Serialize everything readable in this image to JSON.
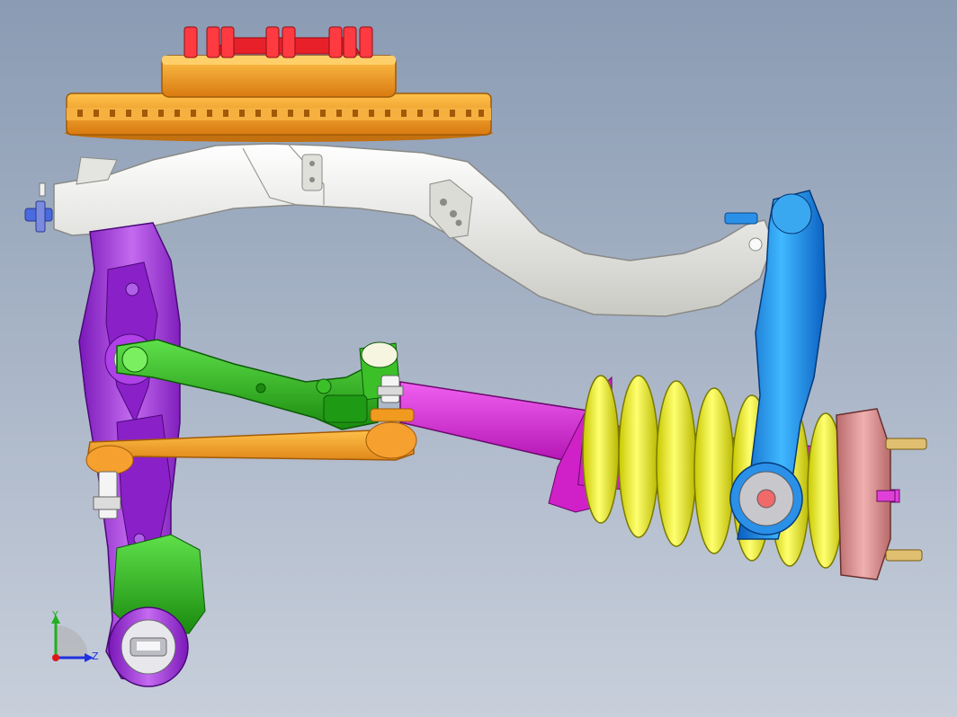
{
  "colors": {
    "bg_top": "#8a9bb3",
    "bg_bottom": "#c4ccd8",
    "subframe": "#eeeeea",
    "lower_arm": "#9a2bd6",
    "toe_link": "#f09a20",
    "upper_link": "#2bb01a",
    "shock_body": "#e01ed8",
    "spring": "#f2f21a",
    "knuckle_arm": "#1f8fe8",
    "hub": "#d88a8a",
    "brake_disc": "#f29d1f",
    "caliper": "#e8202a",
    "axis_x": "#e01818",
    "axis_y": "#20b020",
    "axis_z": "#2030e0"
  },
  "triad": {
    "y_label": "Y",
    "z_label": "Z"
  }
}
